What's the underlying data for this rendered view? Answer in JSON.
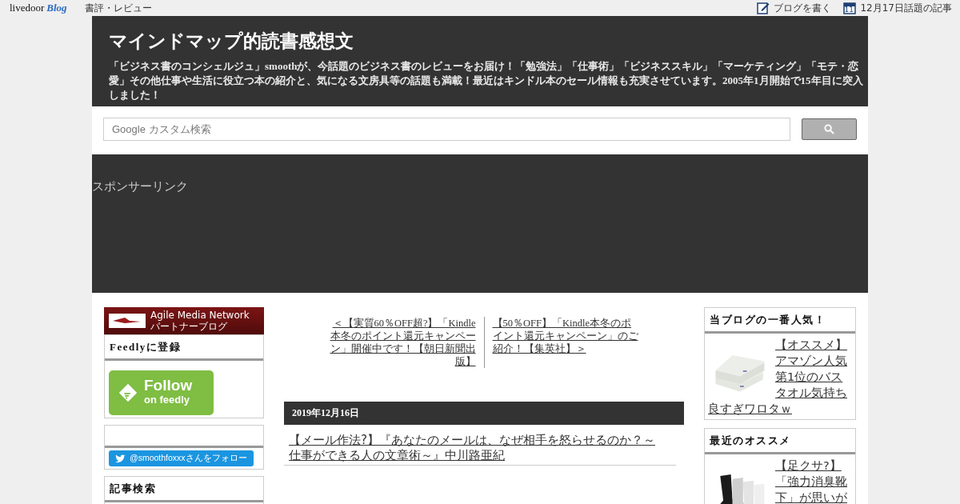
{
  "topbar": {
    "logo": "livedoor",
    "logo_suffix": "Blog",
    "category": "書評・レビュー",
    "links": [
      {
        "kind": "write",
        "label": "ブログを書く"
      },
      {
        "kind": "calendar",
        "label": "12月17日話題の記事",
        "icon_text": "11"
      }
    ]
  },
  "header": {
    "title": "マインドマップ的読書感想文",
    "description": "「ビジネス書のコンシェルジュ」smoothが、今話題のビジネス書のレビューをお届け！「勉強法」「仕事術」「ビジネススキル」「マーケティング」「モテ・恋愛」その他仕事や生活に役立つ本の紹介と、気になる文房具等の話題も満載！最近はキンドル本のセール情報も充実させています。2005年1月開始で15年目に突入しました！"
  },
  "search": {
    "placeholder": "Google カスタム検索"
  },
  "ad": {
    "label": "スポンサーリンク"
  },
  "left": {
    "banner": {
      "line1": "Agile Media Network",
      "line2": "パートナーブログ"
    },
    "widgets": [
      {
        "kind": "feedly",
        "title": "Feedlyに登録",
        "button_line1": "Follow",
        "button_line2": "on feedly"
      },
      {
        "kind": "twitter",
        "button": "@smoothfoxxxさんをフォロー"
      },
      {
        "kind": "plain",
        "title": "記事検索"
      }
    ]
  },
  "pager": {
    "prev": "＜【実質60％OFF超?】「Kindle本冬のポイント還元キャンペーン」開催中です！【朝日新聞出版】",
    "next": "【50％OFF】「Kindle本冬のポイント還元キャンペーン」のご紹介！【集英社】＞"
  },
  "post": {
    "date": "2019年12月16日",
    "title": "【メール作法?】『あなたのメールは、なぜ相手を怒らせるのか？～仕事ができる人の文章術～』中川路亜紀"
  },
  "right": [
    {
      "title": "当ブログの一番人気！",
      "kind": "towel",
      "link": "【オススメ】アマゾン人気第1位のバスタオル気持ち良すぎワロタｗ"
    },
    {
      "title": "最近のオススメ",
      "kind": "socks",
      "link": "【足クサ?】「強力消臭靴下」が思いが"
    }
  ]
}
